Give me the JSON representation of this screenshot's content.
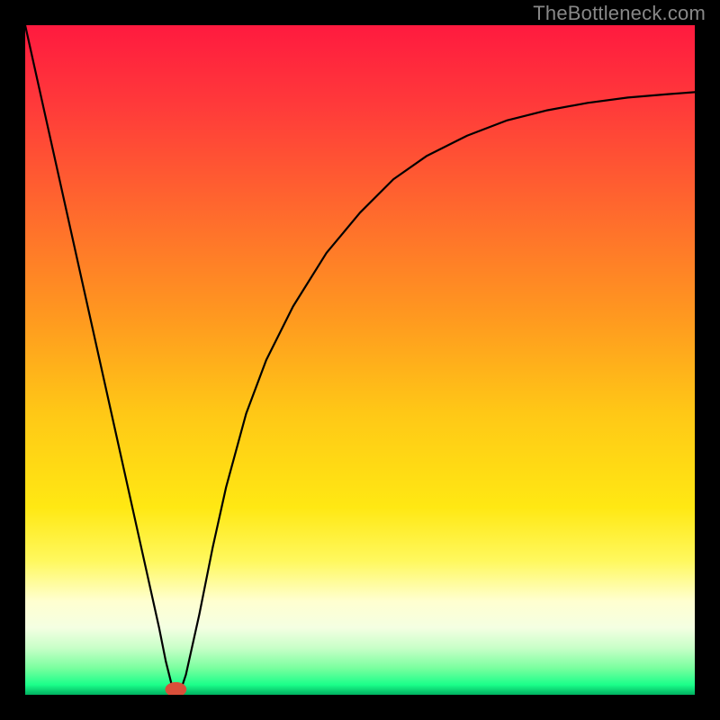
{
  "watermark": "TheBottleneck.com",
  "chart_data": {
    "type": "line",
    "title": "",
    "xlabel": "",
    "ylabel": "",
    "xlim": [
      0,
      100
    ],
    "ylim": [
      0,
      100
    ],
    "grid": false,
    "legend": false,
    "background": {
      "type": "vertical-gradient",
      "stops": [
        {
          "offset": 0.0,
          "color": "#ff1a3f"
        },
        {
          "offset": 0.12,
          "color": "#ff3a3a"
        },
        {
          "offset": 0.28,
          "color": "#ff6a2d"
        },
        {
          "offset": 0.44,
          "color": "#ff9a1f"
        },
        {
          "offset": 0.58,
          "color": "#ffc816"
        },
        {
          "offset": 0.72,
          "color": "#ffe813"
        },
        {
          "offset": 0.8,
          "color": "#fff85e"
        },
        {
          "offset": 0.86,
          "color": "#ffffd0"
        },
        {
          "offset": 0.9,
          "color": "#f4ffe2"
        },
        {
          "offset": 0.93,
          "color": "#c8ffc8"
        },
        {
          "offset": 0.96,
          "color": "#7aff9f"
        },
        {
          "offset": 0.985,
          "color": "#1bff8a"
        },
        {
          "offset": 1.0,
          "color": "#00b060"
        }
      ]
    },
    "series": [
      {
        "name": "bottleneck-curve",
        "color": "#000000",
        "stroke_width": 2.2,
        "x": [
          0,
          4,
          8,
          12,
          16,
          18,
          20,
          21,
          22,
          23,
          24,
          26,
          28,
          30,
          33,
          36,
          40,
          45,
          50,
          55,
          60,
          66,
          72,
          78,
          84,
          90,
          96,
          100
        ],
        "values": [
          100,
          82,
          64,
          46,
          28,
          19,
          10,
          5,
          1,
          0,
          3,
          12,
          22,
          31,
          42,
          50,
          58,
          66,
          72,
          77,
          80.5,
          83.5,
          85.8,
          87.3,
          88.4,
          89.2,
          89.7,
          90
        ]
      }
    ],
    "marker": {
      "name": "optimal-point",
      "x": 22.5,
      "y": 0.8,
      "rx": 1.6,
      "ry": 1.1,
      "fill": "#d94f3a"
    }
  }
}
